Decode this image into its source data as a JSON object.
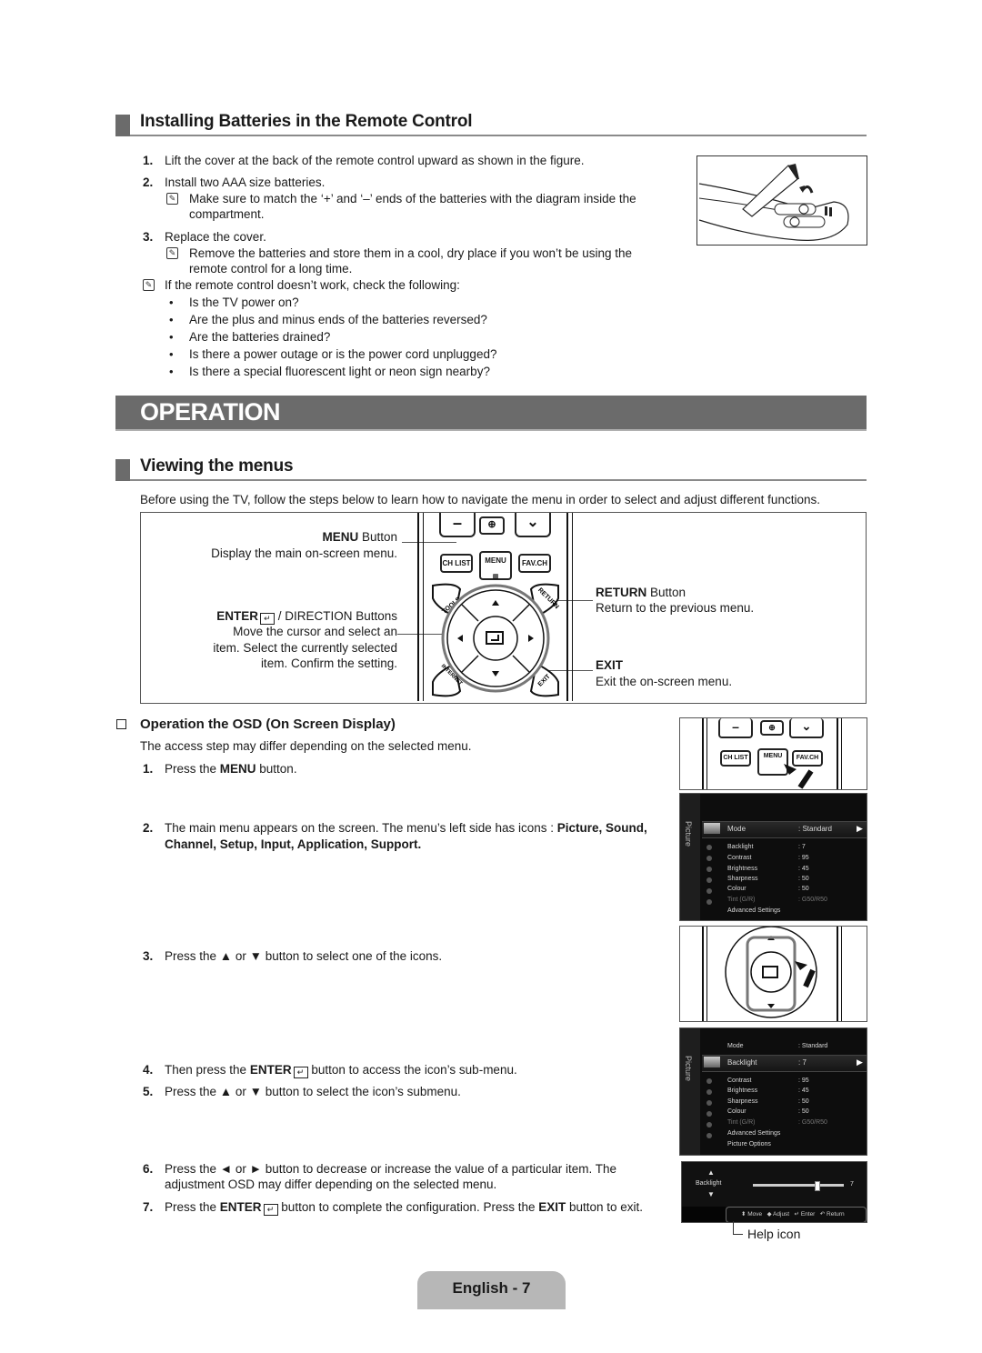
{
  "batteries": {
    "title": "Installing Batteries in the Remote Control",
    "steps": [
      {
        "num": "1.",
        "text": "Lift the cover at the back of the remote control upward as shown in the figure."
      },
      {
        "num": "2.",
        "text": "Install two AAA size batteries.",
        "note": [
          "Make sure to match the ‘+’ and ‘–’ ends of the batteries with the diagram inside the",
          "compartment."
        ]
      },
      {
        "num": "3.",
        "text": "Replace the cover.",
        "note": [
          "Remove the batteries and store them in a cool, dry place if you won’t be using the",
          "remote control for a long time."
        ]
      }
    ],
    "check_note": "If the remote control doesn’t work, check the following:",
    "checks": [
      "Is the TV power on?",
      "Are the plus and minus ends of the batteries reversed?",
      "Are the batteries drained?",
      "Is there a power outage or is the power cord unplugged?",
      "Is there a special fluorescent light or neon sign nearby?"
    ],
    "figure_icon": "remote-battery-cover-figure"
  },
  "operation_banner": "OPERATION",
  "menus": {
    "title": "Viewing the menus",
    "intro": "Before using the TV, follow the steps below to learn how to navigate the menu in order to select and adjust different functions.",
    "callouts": {
      "menu_bold": "MENU",
      "menu_rest": " Button",
      "menu_desc": "Display the main on-screen menu.",
      "enter_bold": "ENTER",
      "enter_rest": " / DIRECTION Buttons",
      "enter_desc": [
        "Move the cursor and select an",
        "item. Select the currently selected",
        "item. Confirm the setting."
      ],
      "return_bold": "RETURN",
      "return_rest": " Button",
      "return_desc": "Return to the previous menu.",
      "exit_bold": "EXIT",
      "exit_desc": "Exit the on-screen menu."
    },
    "remote_buttons": {
      "ch_list": "CH LIST",
      "menu": "MENU",
      "fav_ch": "FAV.CH",
      "tools": "TOOLS",
      "return": "RETURN",
      "internet": "INTERNET",
      "exit": "EXIT"
    }
  },
  "osd": {
    "title": "Operation the OSD (On Screen Display)",
    "subtitle": "The access step may differ depending on the selected menu.",
    "steps": [
      {
        "num": "1.",
        "pre": "Press the ",
        "bold": "MENU",
        "post": " button."
      },
      {
        "num": "2.",
        "pre": "The main menu appears on the screen. The menu’s left side has icons : ",
        "bold": "Picture, Sound,",
        "line2": "Channel, Setup, Input, Application, Support."
      },
      {
        "num": "3.",
        "text": "Press the ▲ or ▼ button to select one of the icons."
      },
      {
        "num": "4.",
        "pre": "Then press the ",
        "bold": "ENTER",
        "post": " button to access the icon’s sub-menu."
      },
      {
        "num": "5.",
        "text": "Press the ▲ or ▼ button to select the icon’s submenu."
      },
      {
        "num": "6.",
        "text": "Press the ◄ or ► button to decrease or increase the value of a particular item. The",
        "line2": "adjustment OSD may differ depending on the selected menu."
      },
      {
        "num": "7.",
        "pre": "Press the ",
        "bold": "ENTER",
        "mid": " button to complete the configuration. Press the ",
        "bold2": "EXIT",
        "post": " button to exit."
      }
    ],
    "screen1": {
      "side_label": "Picture",
      "selected": {
        "label": "Mode",
        "value": ": Standard"
      },
      "rows": [
        {
          "label": "Backlight",
          "value": ": 7"
        },
        {
          "label": "Contrast",
          "value": ": 95"
        },
        {
          "label": "Brightness",
          "value": ": 45"
        },
        {
          "label": "Sharpness",
          "value": ": 50"
        },
        {
          "label": "Colour",
          "value": ": 50"
        },
        {
          "label": "Tint (G/R)",
          "value": ": G50/R50"
        },
        {
          "label": "Advanced Settings",
          "value": ""
        }
      ]
    },
    "screen2": {
      "side_label": "Picture",
      "top": {
        "label": "Mode",
        "value": ": Standard"
      },
      "selected": {
        "label": "Backlight",
        "value": ": 7"
      },
      "rows": [
        {
          "label": "Contrast",
          "value": ": 95"
        },
        {
          "label": "Brightness",
          "value": ": 45"
        },
        {
          "label": "Sharpness",
          "value": ": 50"
        },
        {
          "label": "Colour",
          "value": ": 50"
        },
        {
          "label": "Tint (G/R)",
          "value": ": G50/R50"
        },
        {
          "label": "Advanced Settings",
          "value": ""
        },
        {
          "label": "Picture Options",
          "value": ""
        }
      ]
    },
    "slider": {
      "label": "Backlight",
      "value": "7",
      "fraction": 0.7,
      "help": [
        {
          "icon": "up-down-icon",
          "glyph": "⬍",
          "label": "Move"
        },
        {
          "icon": "left-right-icon",
          "glyph": "◆",
          "label": "Adjust"
        },
        {
          "icon": "enter-icon",
          "glyph": "↵",
          "label": "Enter"
        },
        {
          "icon": "return-icon",
          "glyph": "↶",
          "label": "Return"
        }
      ],
      "help_caption": "Help icon"
    }
  },
  "footer": {
    "page_label": "English - 7"
  }
}
